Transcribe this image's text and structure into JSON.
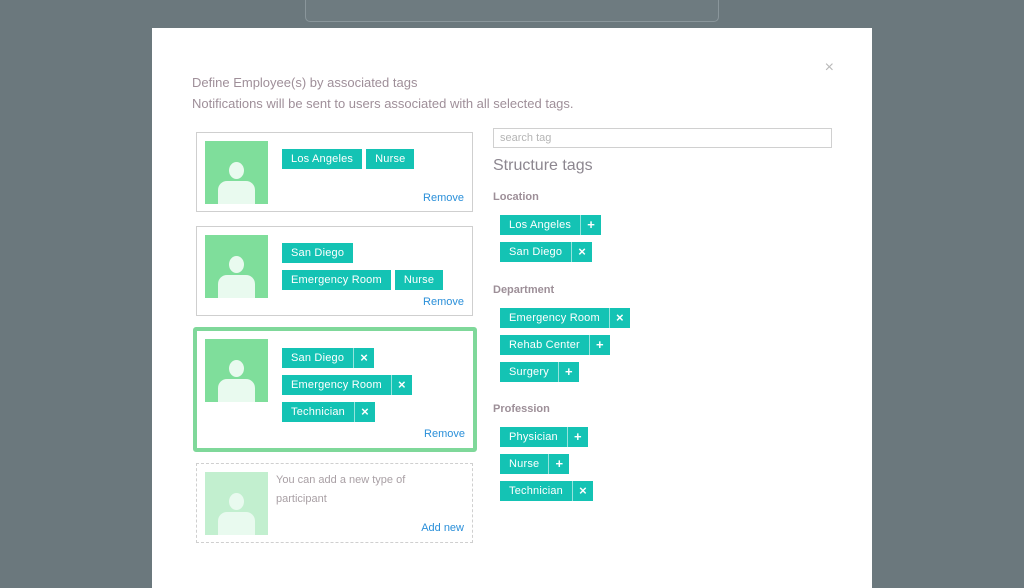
{
  "modal": {
    "close_label": "×",
    "header_line1": "Define Employee(s) by associated tags",
    "header_line2": "Notifications will be sent to users associated with all selected tags."
  },
  "participants": [
    {
      "tags": [
        "Los Angeles",
        "Nurse"
      ],
      "remove_label": "Remove"
    },
    {
      "tags": [
        "San Diego",
        "Emergency Room",
        "Nurse"
      ],
      "remove_label": "Remove"
    },
    {
      "tags": [
        "San Diego",
        "Emergency Room",
        "Technician"
      ],
      "remove_label": "Remove",
      "selected": true
    }
  ],
  "add_new": {
    "hint": "You can add a new type of participant",
    "label": "Add new"
  },
  "tag_panel": {
    "search_placeholder": "search tag",
    "title": "Structure tags",
    "sections": [
      {
        "name": "Location",
        "tags": [
          {
            "label": "Los Angeles",
            "action": "+"
          },
          {
            "label": "San Diego",
            "action": "×"
          }
        ]
      },
      {
        "name": "Department",
        "tags": [
          {
            "label": "Emergency Room",
            "action": "×"
          },
          {
            "label": "Rehab Center",
            "action": "+"
          },
          {
            "label": "Surgery",
            "action": "+"
          }
        ]
      },
      {
        "name": "Profession",
        "tags": [
          {
            "label": "Physician",
            "action": "+"
          },
          {
            "label": "Nurse",
            "action": "+"
          },
          {
            "label": "Technician",
            "action": "×"
          }
        ]
      }
    ]
  },
  "colors": {
    "tag": "#14c3b4",
    "avatar": "#7fde9b",
    "selected_border": "#7fd89a",
    "link": "#2a8fd9"
  }
}
